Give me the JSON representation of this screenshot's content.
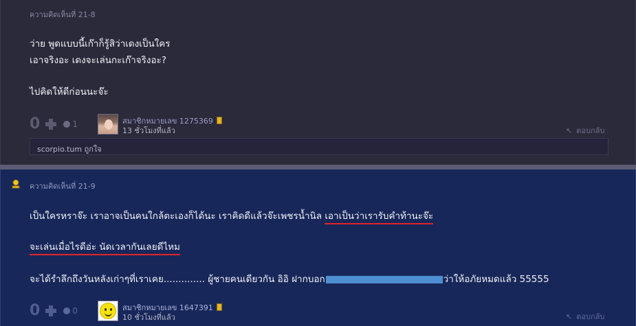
{
  "comment1": {
    "label": "ความคิดเห็นที่ 21-8",
    "lines": [
      "ว่าย พูดแบบนี้เก๊าก็รู้สิว่าเดงเป็นใคร",
      "เอาจริงอะ เดงจะเล่นกะเก๊าจริงอะ?",
      "ไปคิดให้ดีก่อนนะจ๊ะ"
    ],
    "votes": "0",
    "emotions": "1",
    "member": "สมาชิกหมายเลข 1275369",
    "time": "13 ชั่วโมงที่แล้ว",
    "reply": "ตอบกลับ",
    "liked_by": "scorpio.tum ถูกใจ"
  },
  "comment2": {
    "label": "ความคิดเห็นที่ 21-9",
    "line1_a": "เป็นใครหราจ๊ะ เราอาจเป็นคนใกล้ตะเองก็ได้นะ เราคิดดีแล้วจ๊ะเพชรน้ำนิล ",
    "line1_b": "เอาเป็นว่าเรารับคำท้านะจ๊ะ",
    "line2": "จะเล่นเมื่อไรดีอ่ะ นัดเวลากันเลยดีไหม",
    "line3_a": "จะได้รำลึกถึงวันหลังเก่าๆที่เราเคย.............. ผู้ชายคนเดียวกัน อิอิ ฝากบอก",
    "line3_b": "ว่าให้อภัยหมดแล้ว 55555",
    "votes": "0",
    "emotions": "0",
    "member": "สมาชิกหมายเลข 1647391",
    "time": "10 ชั่วโมงที่แล้ว",
    "reply": "ตอบกลับ"
  },
  "colors": {
    "comment1_bg": "#2b2a3b",
    "comment2_bg": "#18275a",
    "underline": "#e2232a",
    "redaction": "#4d8fd1"
  },
  "icons": {
    "vote": "plus-icon",
    "emotion": "emotion-icon",
    "reply": "reply-arrow-icon",
    "badge": "member-badge-icon",
    "owner": "owner-icon"
  }
}
